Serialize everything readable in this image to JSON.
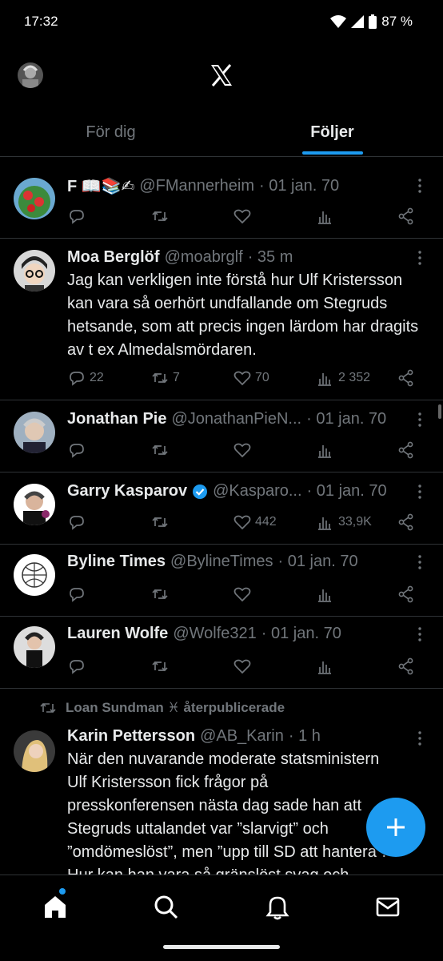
{
  "status_bar": {
    "time": "17:32",
    "battery": "87 %"
  },
  "header": {
    "logo": "x-logo"
  },
  "tabs": [
    {
      "label": "För dig",
      "active": false
    },
    {
      "label": "Följer",
      "active": true
    }
  ],
  "posts": [
    {
      "name": "F 📖📚✍",
      "handle": "@FMannerheim",
      "time": "· 01 jan. 70",
      "text": "",
      "replies": "",
      "reposts": "",
      "likes": "",
      "views": ""
    },
    {
      "name": "Moa Berglöf",
      "handle": "@moabrglf",
      "time": "· 35 m",
      "text": "Jag kan verkligen inte förstå hur Ulf Kristersson kan vara så oerhört undfallande om Stegruds hetsande, som att precis ingen lärdom har dragits av t ex Almedalsmördaren.",
      "replies": "22",
      "reposts": "7",
      "likes": "70",
      "views": "2 352"
    },
    {
      "name": "Jonathan Pie",
      "handle": "@JonathanPieN...",
      "time": "· 01 jan. 70",
      "text": "",
      "replies": "",
      "reposts": "",
      "likes": "",
      "views": ""
    },
    {
      "name": "Garry Kasparov",
      "handle": "@Kasparo...",
      "time": "· 01 jan. 70",
      "verified": true,
      "text": "",
      "replies": "",
      "reposts": "",
      "likes": "442",
      "views": "33,9K"
    },
    {
      "name": "Byline Times",
      "handle": "@BylineTimes",
      "time": "· 01 jan. 70",
      "text": "",
      "replies": "",
      "reposts": "",
      "likes": "",
      "views": ""
    },
    {
      "name": "Lauren Wolfe",
      "handle": "@Wolfe321",
      "time": "· 01 jan. 70",
      "text": "",
      "replies": "",
      "reposts": "",
      "likes": "",
      "views": ""
    }
  ],
  "repost_notice": {
    "text": "Loan Sundman ♓ återpublicerade"
  },
  "last_post": {
    "name": "Karin Pettersson",
    "handle": "@AB_Karin",
    "time": "· 1 h",
    "line1": "När den nuvarande moderate statsministern",
    "line2": "Ulf Kristersson fick frågor på",
    "line3": "presskonferensen nästa dag sade han att",
    "line4": "Stegruds uttalandet var ”slarvigt” och",
    "line5": "”omdömeslöst”, men ”upp till SD att hantera”.",
    "line6": "Hur kan han vara så gränslöst svag och"
  },
  "colors": {
    "accent": "#1d9bf0",
    "background": "#000000",
    "muted": "#71767b",
    "divider": "#2f3336"
  },
  "bottom_nav": [
    "home-icon",
    "search-icon",
    "bell-icon",
    "mail-icon"
  ]
}
